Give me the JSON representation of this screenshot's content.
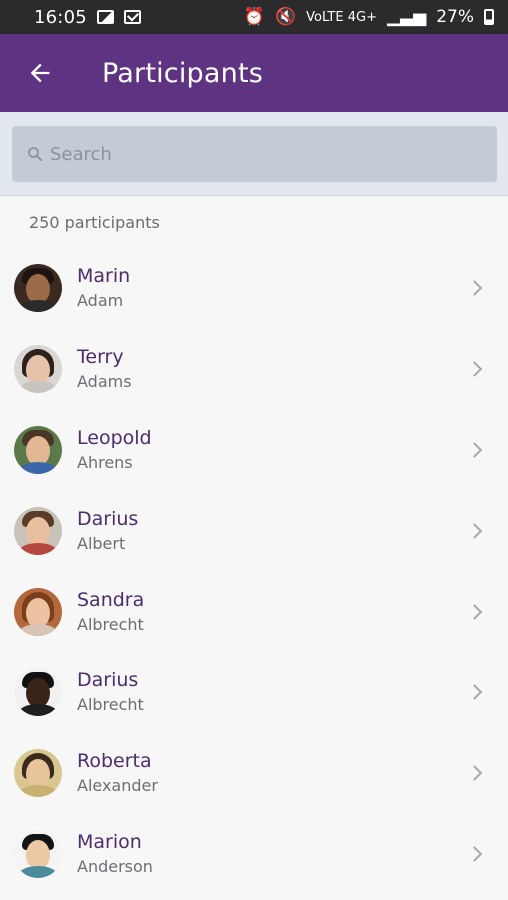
{
  "status_bar": {
    "time": "16:05",
    "network": "VoLTE 4G+",
    "battery": "27%"
  },
  "app_bar": {
    "title": "Participants"
  },
  "search": {
    "placeholder": "Search"
  },
  "participant_count": "250 participants",
  "participants": [
    {
      "first": "Marin",
      "last": "Adam"
    },
    {
      "first": "Terry",
      "last": "Adams"
    },
    {
      "first": "Leopold",
      "last": "Ahrens"
    },
    {
      "first": "Darius",
      "last": "Albert"
    },
    {
      "first": "Sandra",
      "last": "Albrecht"
    },
    {
      "first": "Darius",
      "last": "Albrecht"
    },
    {
      "first": "Roberta",
      "last": "Alexander"
    },
    {
      "first": "Marion",
      "last": "Anderson"
    }
  ],
  "colors": {
    "app_bar": "#5e3482",
    "status_bar": "#2b2b2e",
    "name_text": "#4c2d6a",
    "search_bg": "#c3cbd5"
  }
}
